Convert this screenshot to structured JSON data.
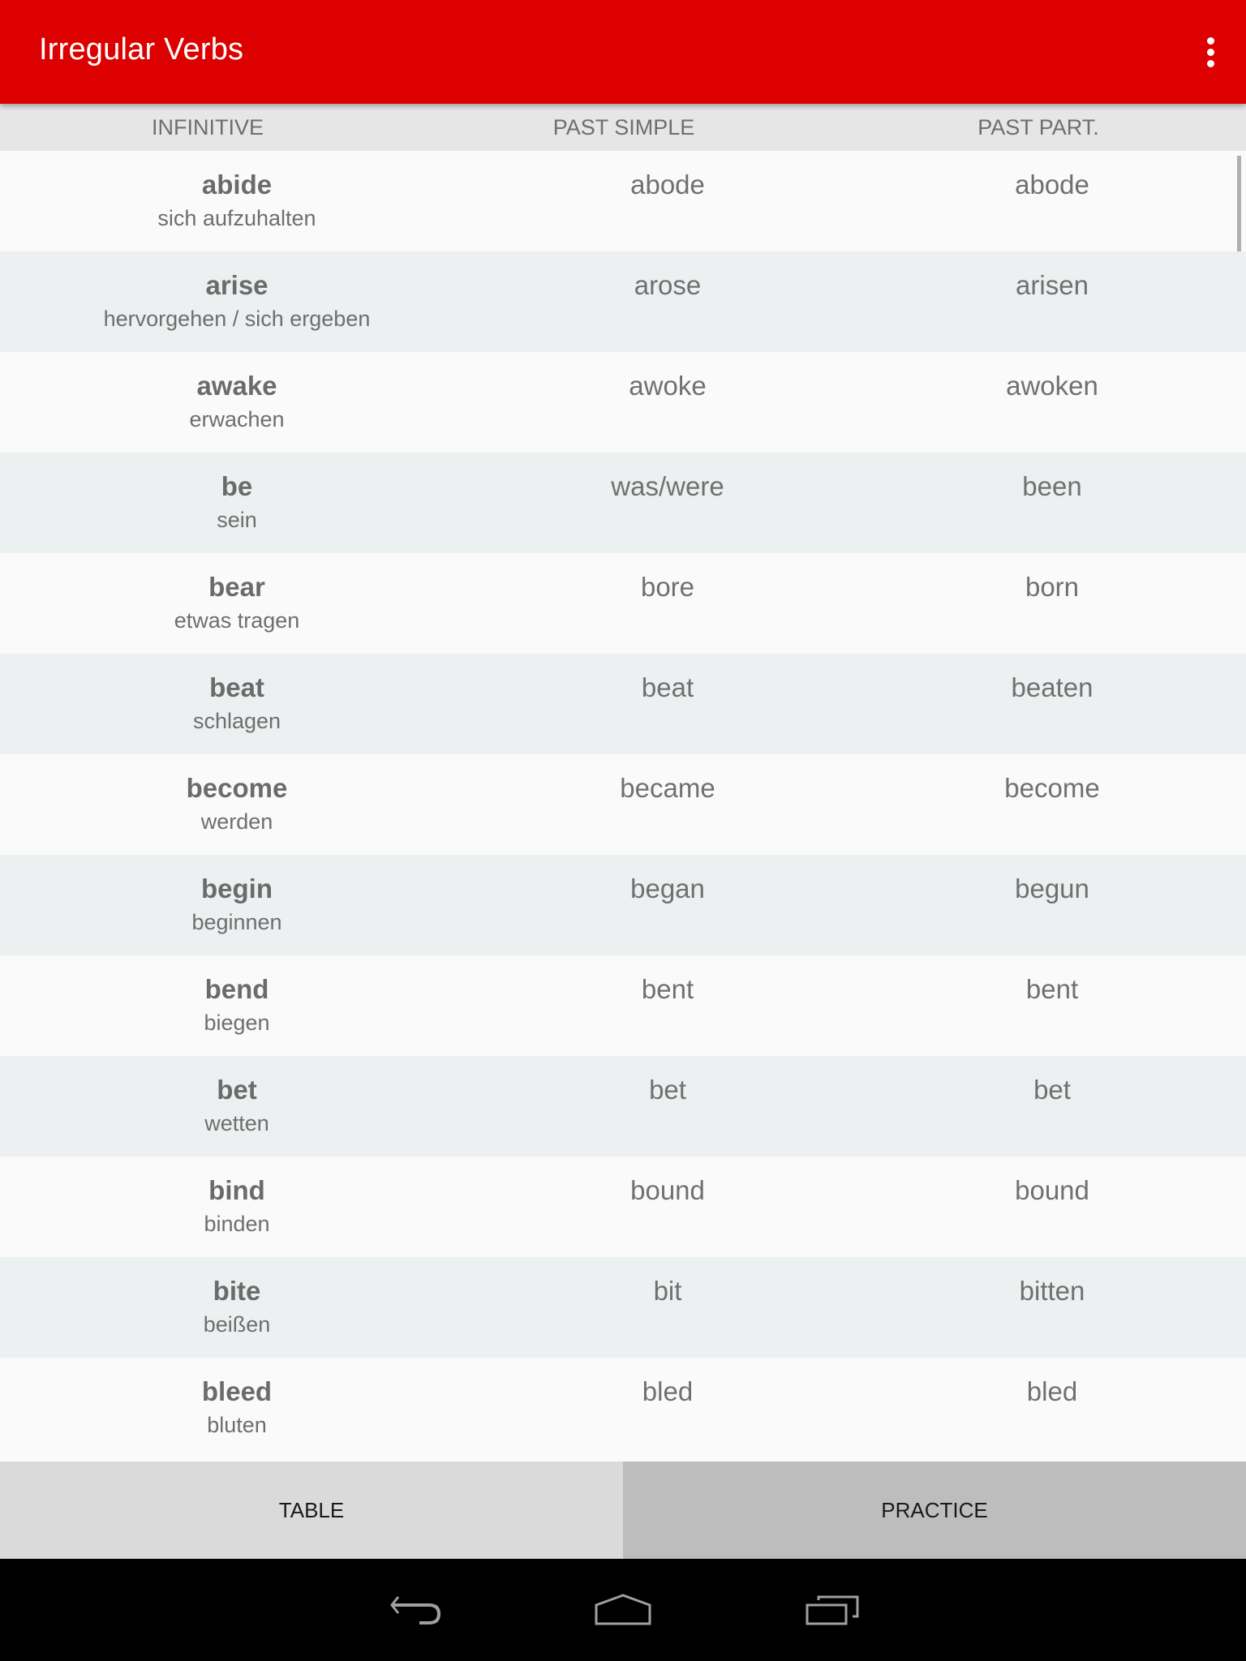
{
  "app": {
    "title": "Irregular Verbs",
    "accent_color": "#dd0000",
    "menu_icon": "overflow-menu-icon"
  },
  "table_header": {
    "infinitive": "INFINITIVE",
    "past_simple": "PAST SIMPLE",
    "past_participle": "PAST PART."
  },
  "verbs": [
    {
      "infinitive": "abide",
      "translation": "sich aufzuhalten",
      "past_simple": "abode",
      "past_participle": "abode"
    },
    {
      "infinitive": "arise",
      "translation": "hervorgehen / sich ergeben",
      "past_simple": "arose",
      "past_participle": "arisen"
    },
    {
      "infinitive": "awake",
      "translation": "erwachen",
      "past_simple": "awoke",
      "past_participle": "awoken"
    },
    {
      "infinitive": "be",
      "translation": "sein",
      "past_simple": "was/were",
      "past_participle": "been"
    },
    {
      "infinitive": "bear",
      "translation": "etwas tragen",
      "past_simple": "bore",
      "past_participle": "born"
    },
    {
      "infinitive": "beat",
      "translation": "schlagen",
      "past_simple": "beat",
      "past_participle": "beaten"
    },
    {
      "infinitive": "become",
      "translation": "werden",
      "past_simple": "became",
      "past_participle": "become"
    },
    {
      "infinitive": "begin",
      "translation": "beginnen",
      "past_simple": "began",
      "past_participle": "begun"
    },
    {
      "infinitive": "bend",
      "translation": "biegen",
      "past_simple": "bent",
      "past_participle": "bent"
    },
    {
      "infinitive": "bet",
      "translation": "wetten",
      "past_simple": "bet",
      "past_participle": "bet"
    },
    {
      "infinitive": "bind",
      "translation": "binden",
      "past_simple": "bound",
      "past_participle": "bound"
    },
    {
      "infinitive": "bite",
      "translation": "beißen",
      "past_simple": "bit",
      "past_participle": "bitten"
    },
    {
      "infinitive": "bleed",
      "translation": "bluten",
      "past_simple": "bled",
      "past_participle": "bled"
    }
  ],
  "bottom_tabs": {
    "table": "TABLE",
    "practice": "PRACTICE"
  },
  "system_nav": {
    "back": "back-icon",
    "home": "home-icon",
    "recents": "recent-apps-icon"
  }
}
